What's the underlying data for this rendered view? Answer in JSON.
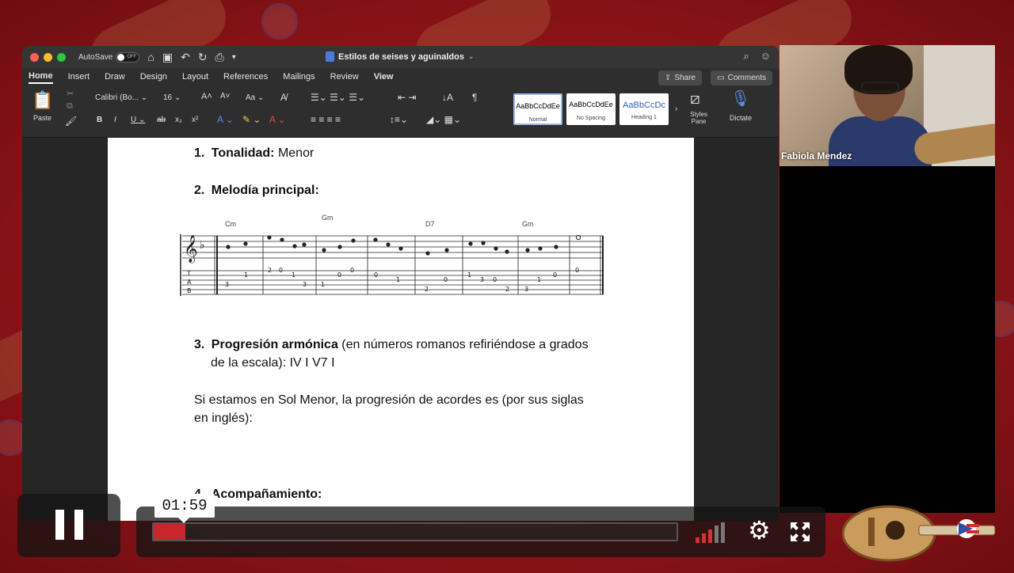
{
  "word": {
    "autosave_label": "AutoSave",
    "autosave_state": "OFF",
    "doc_title": "Estilos de seises y aguinaldos",
    "tabs": [
      "Home",
      "Insert",
      "Draw",
      "Design",
      "Layout",
      "References",
      "Mailings",
      "Review",
      "View"
    ],
    "active_tab": "Home",
    "share_label": "Share",
    "comments_label": "Comments",
    "ribbon": {
      "paste_label": "Paste",
      "font_name": "Calibri (Bo...",
      "font_size": "16",
      "styles": [
        {
          "sample": "AaBbCcDdEe",
          "name": "Normal"
        },
        {
          "sample": "AaBbCcDdEe",
          "name": "No Spacing"
        },
        {
          "sample": "AaBbCcDc",
          "name": "Heading 1"
        }
      ],
      "styles_pane_label": "Styles Pane",
      "dictate_label": "Dictate"
    }
  },
  "document": {
    "item1_num": "1.",
    "item1_bold": "Tonalidad:",
    "item1_text": " Menor",
    "item2_num": "2.",
    "item2_bold": "Melodía principal:",
    "item3_num": "3.",
    "item3_bold": "Progresión armónica",
    "item3_text": " (en números romanos refiriéndose a grados",
    "item3_line2": "de la escala): IV  I   V7  I",
    "para_line1": "Si estamos en Sol Menor, la progresión de acordes es (por sus siglas",
    "para_line2": "en inglés):",
    "item4_num": "4.",
    "item4_bold": "Acompañamiento:"
  },
  "score": {
    "chords": [
      "Cm",
      "Gm",
      "D7",
      "Gm"
    ]
  },
  "participant": {
    "name": "Fabiola Mendez"
  },
  "player": {
    "time": "01:59",
    "progress": 0.06,
    "state": "playing"
  },
  "icons": {
    "pause": "pause-icon",
    "settings": "gear-icon",
    "fullscreen": "fullscreen-icon",
    "volume": "volume-bars-icon"
  },
  "colors": {
    "background": "#8c1518",
    "progress": "#c8262b",
    "volume_active": "#d63031"
  }
}
